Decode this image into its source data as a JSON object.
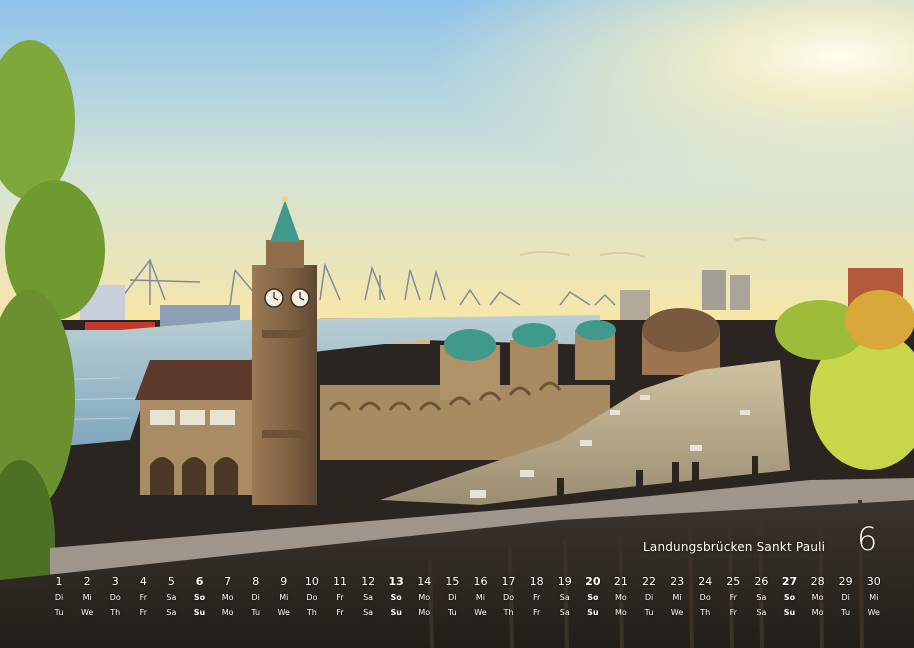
{
  "caption": "Landungsbrücken Sankt Pauli",
  "month_number": "6",
  "days": [
    {
      "num": "1",
      "de": "Di",
      "en": "Tu",
      "sunday": false
    },
    {
      "num": "2",
      "de": "Mi",
      "en": "We",
      "sunday": false
    },
    {
      "num": "3",
      "de": "Do",
      "en": "Th",
      "sunday": false
    },
    {
      "num": "4",
      "de": "Fr",
      "en": "Fr",
      "sunday": false
    },
    {
      "num": "5",
      "de": "Sa",
      "en": "Sa",
      "sunday": false
    },
    {
      "num": "6",
      "de": "So",
      "en": "Su",
      "sunday": true
    },
    {
      "num": "7",
      "de": "Mo",
      "en": "Mo",
      "sunday": false
    },
    {
      "num": "8",
      "de": "Di",
      "en": "Tu",
      "sunday": false
    },
    {
      "num": "9",
      "de": "Mi",
      "en": "We",
      "sunday": false
    },
    {
      "num": "10",
      "de": "Do",
      "en": "Th",
      "sunday": false
    },
    {
      "num": "11",
      "de": "Fr",
      "en": "Fr",
      "sunday": false
    },
    {
      "num": "12",
      "de": "Sa",
      "en": "Sa",
      "sunday": false
    },
    {
      "num": "13",
      "de": "So",
      "en": "Su",
      "sunday": true
    },
    {
      "num": "14",
      "de": "Mo",
      "en": "Mo",
      "sunday": false
    },
    {
      "num": "15",
      "de": "Di",
      "en": "Tu",
      "sunday": false
    },
    {
      "num": "16",
      "de": "Mi",
      "en": "We",
      "sunday": false
    },
    {
      "num": "17",
      "de": "Do",
      "en": "Th",
      "sunday": false
    },
    {
      "num": "18",
      "de": "Fr",
      "en": "Fr",
      "sunday": false
    },
    {
      "num": "19",
      "de": "Sa",
      "en": "Sa",
      "sunday": false
    },
    {
      "num": "20",
      "de": "So",
      "en": "Su",
      "sunday": true
    },
    {
      "num": "21",
      "de": "Mo",
      "en": "Mo",
      "sunday": false
    },
    {
      "num": "22",
      "de": "Di",
      "en": "Tu",
      "sunday": false
    },
    {
      "num": "23",
      "de": "Mi",
      "en": "We",
      "sunday": false
    },
    {
      "num": "24",
      "de": "Do",
      "en": "Th",
      "sunday": false
    },
    {
      "num": "25",
      "de": "Fr",
      "en": "Fr",
      "sunday": false
    },
    {
      "num": "26",
      "de": "Sa",
      "en": "Sa",
      "sunday": false
    },
    {
      "num": "27",
      "de": "So",
      "en": "Su",
      "sunday": true
    },
    {
      "num": "28",
      "de": "Mo",
      "en": "Mo",
      "sunday": false
    },
    {
      "num": "29",
      "de": "Di",
      "en": "Tu",
      "sunday": false
    },
    {
      "num": "30",
      "de": "Mi",
      "en": "We",
      "sunday": false
    }
  ],
  "colors": {
    "sky_top": "#8fc3ea",
    "sky_horizon": "#f7e6a8",
    "sun_glow": "#fff7d6",
    "water": "#8fb4c9",
    "tower_stone": "#8a6a48",
    "copper_dome": "#3f9a8c",
    "foliage": "#7fa83a",
    "foliage_light": "#c8d64a",
    "plaza": "#2c2722",
    "text": "#ffffff"
  }
}
